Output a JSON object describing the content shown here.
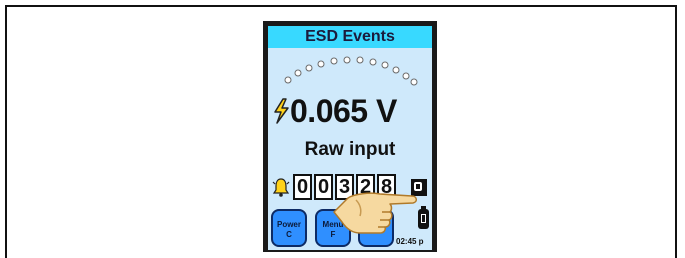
{
  "screen": {
    "title": "ESD Events",
    "reading": "0.065 V",
    "mode": "Raw input",
    "counter": [
      "0",
      "0",
      "3",
      "2",
      "8"
    ],
    "softkeys": [
      {
        "line1": "Power",
        "line2": "C"
      },
      {
        "line1": "Menu",
        "line2": "F"
      },
      {
        "line1": "",
        "line2": ""
      }
    ],
    "time": "02:45 p"
  },
  "colors": {
    "title_bar": "#38d9ff",
    "screen_bg": "#cfe9fb",
    "softkey": "#2f8fff",
    "alert_icon": "#ffd21a"
  },
  "icons": [
    "lightning-bolt-icon",
    "bell-icon",
    "reset-icon",
    "battery-icon",
    "pointing-hand-icon"
  ]
}
